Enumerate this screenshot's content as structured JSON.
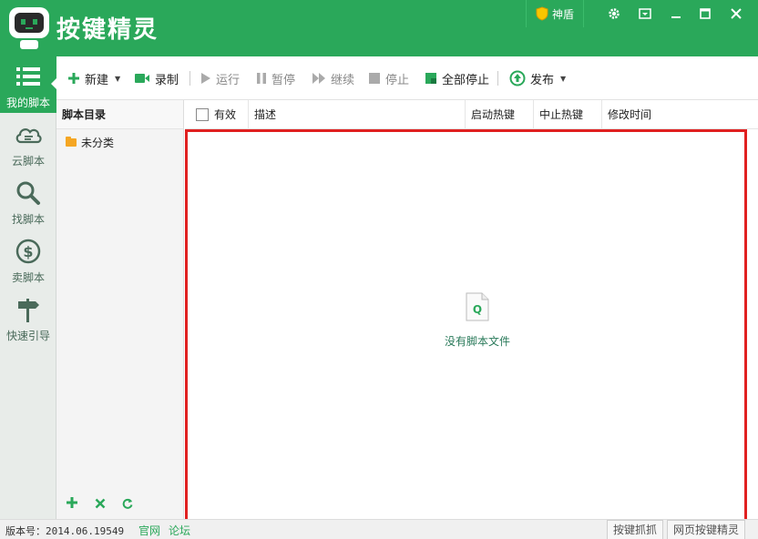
{
  "app": {
    "title": "按键精灵"
  },
  "titlebar": {
    "shield_label": "神盾",
    "controls": [
      "gear-icon",
      "skin-icon",
      "minimize-icon",
      "maximize-icon",
      "close-icon"
    ]
  },
  "nav": {
    "items": [
      {
        "label": "我的脚本",
        "icon": "list-icon",
        "active": true
      },
      {
        "label": "云脚本",
        "icon": "cloud-icon"
      },
      {
        "label": "找脚本",
        "icon": "search-icon"
      },
      {
        "label": "卖脚本",
        "icon": "dollar-icon"
      },
      {
        "label": "快速引导",
        "icon": "signpost-icon"
      }
    ]
  },
  "toolbar": {
    "new": "新建",
    "record": "录制",
    "run": "运行",
    "pause": "暂停",
    "resume": "继续",
    "stop": "停止",
    "stop_all": "全部停止",
    "publish": "发布"
  },
  "directory": {
    "header": "脚本目录",
    "items": [
      "未分类"
    ]
  },
  "table": {
    "columns": [
      "有效",
      "描述",
      "启动热键",
      "中止热键",
      "修改时间"
    ]
  },
  "content": {
    "empty_text": "没有脚本文件"
  },
  "statusbar": {
    "version_label": "版本号：",
    "version": "2014.06.19549",
    "official_site": "官网",
    "forum": "论坛",
    "btn_capture": "按键抓抓",
    "btn_web": "网页按键精灵"
  },
  "colors": {
    "brand_green": "#2aa85a",
    "highlight_red": "#e02020"
  }
}
